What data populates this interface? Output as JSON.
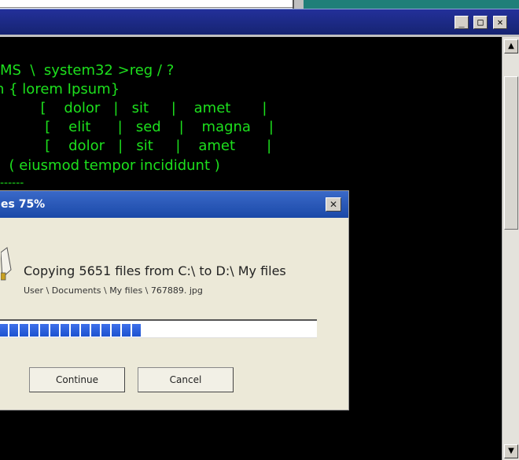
{
  "window": {
    "buttons": {
      "minimize": "_",
      "maximize": "□",
      "close": "✕"
    }
  },
  "console": {
    "lines": [
      "MS  \\  system32 >reg / ?",
      "n { lorem Ipsum}",
      "         [    dolor   |   sit     |    amet       |",
      "          [    elit      |   sed    |    magna    |",
      "          [    dolor   |   sit     |    amet       |",
      "  ( eiusmod tempor incididunt )",
      "------"
    ]
  },
  "scrollbar": {
    "up": "▲",
    "down": "▼"
  },
  "dialog": {
    "title": "es 75%",
    "close": "✕",
    "message": "Copying  5651 files from C:\\ to D:\\ My files",
    "path": "User \\ Documents \\ My files \\ 767889. jpg",
    "progress_percent": 75,
    "progress_segments_filled": 14,
    "buttons": {
      "continue": "Continue",
      "cancel": "Cancel"
    }
  },
  "colors": {
    "console_text": "#1de01d",
    "title_bar": "#1b2a80",
    "dialog_title": "#2d5cc0",
    "progress": "#2a5ee0"
  }
}
